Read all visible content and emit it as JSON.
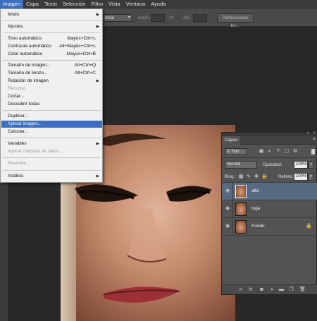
{
  "menubar": {
    "items": [
      {
        "label": "Imagen",
        "active": true
      },
      {
        "label": "Capa"
      },
      {
        "label": "Texto"
      },
      {
        "label": "Selección"
      },
      {
        "label": "Filtro"
      },
      {
        "label": "Vista"
      },
      {
        "label": "Ventana"
      },
      {
        "label": "Ayuda"
      }
    ]
  },
  "options_bar": {
    "style_value": "rmal",
    "width_label": "Anch.:",
    "height_label": "Alt.:",
    "refine_button": "Perfeccionar bo..."
  },
  "image_menu": {
    "items": [
      {
        "label": "Modo",
        "shortcut": "",
        "submenu": true
      },
      {
        "label": "Ajustes",
        "shortcut": "",
        "submenu": true
      },
      {
        "label": "Tono automático",
        "shortcut": "Mayús+Ctrl+L"
      },
      {
        "label": "Contraste automático",
        "shortcut": "Alt+Mayús+Ctrl+L"
      },
      {
        "label": "Color automático",
        "shortcut": "Mayús+Ctrl+B"
      },
      {
        "label": "Tamaño de imagen...",
        "shortcut": "Alt+Ctrl+Q"
      },
      {
        "label": "Tamaño de lienzo...",
        "shortcut": "Alt+Ctrl+C"
      },
      {
        "label": "Rotación de imagen",
        "shortcut": "",
        "submenu": true
      },
      {
        "label": "Recortar",
        "shortcut": "",
        "disabled": true
      },
      {
        "label": "Cortar...",
        "shortcut": ""
      },
      {
        "label": "Descubrir todas",
        "shortcut": ""
      },
      {
        "label": "Duplicar...",
        "shortcut": ""
      },
      {
        "label": "Aplicar imagen...",
        "shortcut": "",
        "highlighted": true
      },
      {
        "label": "Calcular...",
        "shortcut": ""
      },
      {
        "label": "Variables",
        "shortcut": "",
        "submenu": true
      },
      {
        "label": "Aplicar conjunto de datos...",
        "shortcut": "",
        "disabled": true
      },
      {
        "label": "Reventar...",
        "shortcut": "",
        "disabled": true
      },
      {
        "label": "Análisis",
        "shortcut": "",
        "submenu": true
      }
    ]
  },
  "layers_panel": {
    "tab_label": "Capas",
    "filter_label": "Tipo",
    "blend_mode": "Normal",
    "opacity_label": "Opacidad:",
    "opacity_value": "100%",
    "lock_label": "Bloq.:",
    "fill_label": "Relleno:",
    "fill_value": "100%",
    "layers": [
      {
        "name": "alta",
        "selected": true,
        "locked": false,
        "italic": false
      },
      {
        "name": "baja",
        "selected": false,
        "locked": false,
        "italic": false
      },
      {
        "name": "Fondo",
        "selected": false,
        "locked": true,
        "italic": true
      }
    ]
  },
  "colors": {
    "menu_highlight": "#3c6fbf",
    "layer_selected": "#566a82",
    "panel_bg": "#535353",
    "workspace_bg": "#282828"
  }
}
